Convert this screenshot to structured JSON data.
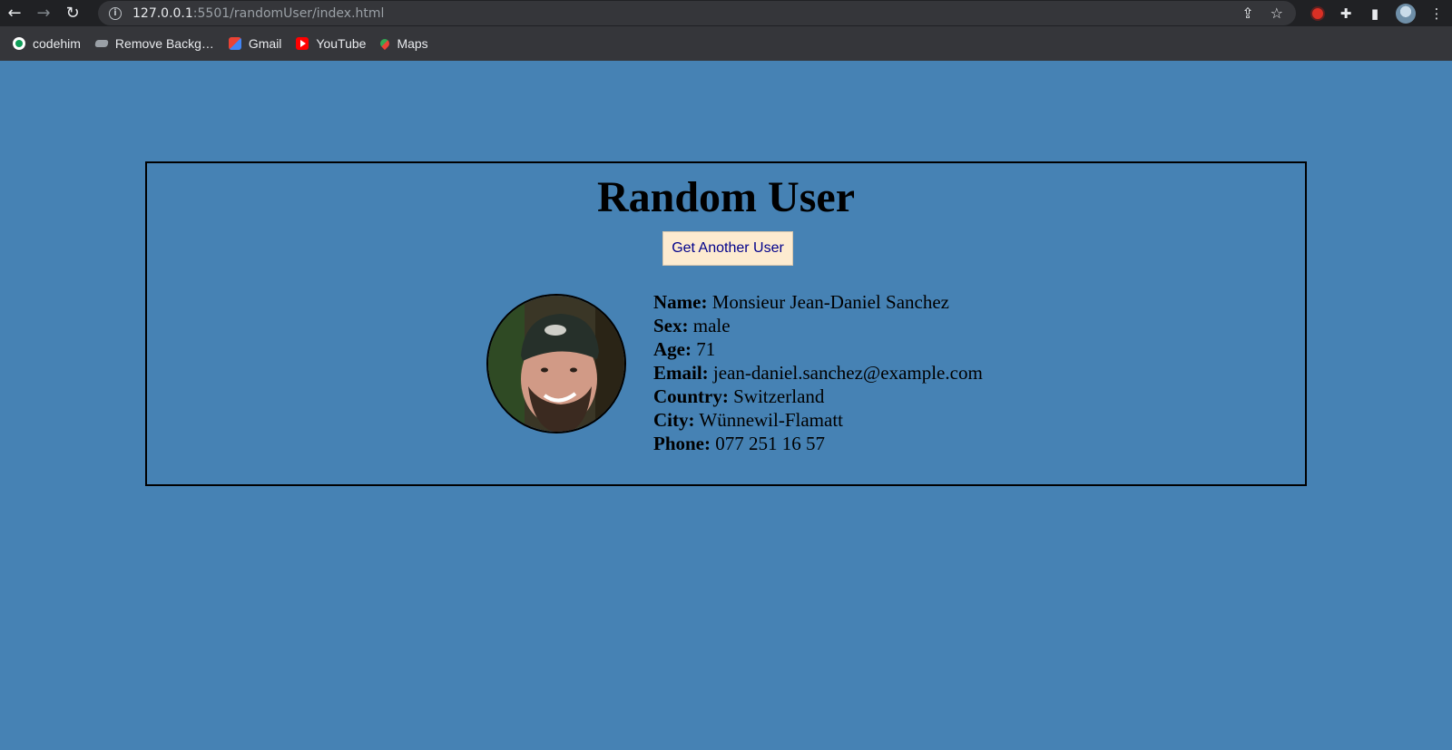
{
  "browser": {
    "url_host": "127.0.0.1",
    "url_rest": ":5501/randomUser/index.html",
    "bookmarks": [
      {
        "label": "codehim",
        "icon": "codehim-favicon"
      },
      {
        "label": "Remove Backg…",
        "icon": "remove-bg-favicon"
      },
      {
        "label": "Gmail",
        "icon": "gmail-favicon"
      },
      {
        "label": "YouTube",
        "icon": "youtube-favicon"
      },
      {
        "label": "Maps",
        "icon": "maps-favicon"
      }
    ]
  },
  "page": {
    "background": "#4682b4",
    "title": "Random User",
    "button_label": "Get Another User",
    "user": {
      "name_label": "Name:",
      "name": "Monsieur Jean-Daniel Sanchez",
      "sex_label": "Sex:",
      "sex": "male",
      "age_label": "Age:",
      "age": "71",
      "email_label": "Email:",
      "email": "jean-daniel.sanchez@example.com",
      "country_label": "Country:",
      "country": "Switzerland",
      "city_label": "City:",
      "city": "Wünnewil-Flamatt",
      "phone_label": "Phone:",
      "phone": "077 251 16 57"
    }
  }
}
